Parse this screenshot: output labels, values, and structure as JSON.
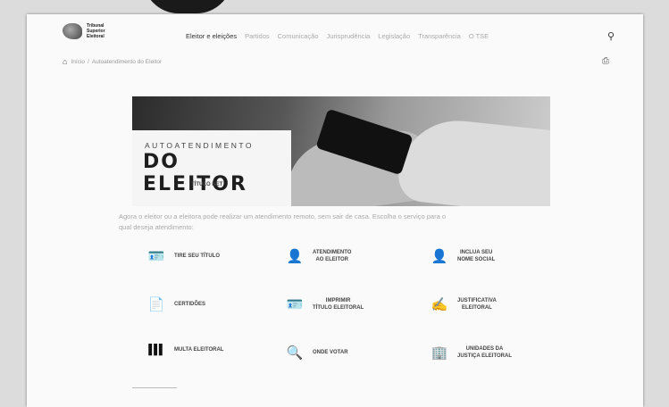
{
  "logo": {
    "line1": "Tribunal",
    "line2": "Superior",
    "line3": "Eleitoral"
  },
  "nav": {
    "items": [
      "Eleitor e eleições",
      "Partidos",
      "Comunicação",
      "Jurisprudência",
      "Legislação",
      "Transparência",
      "O TSE"
    ]
  },
  "breadcrumb": {
    "items": [
      "Início",
      "/",
      "Autoatendimento do Eleitor"
    ]
  },
  "banner": {
    "line1": "AUTOATENDIMENTO",
    "line2": "DO ELEITOR",
    "line3": "TÍTULO NET"
  },
  "intro": "Agora o eleitor ou a eleitora pode realizar um atendimento remoto, sem sair de casa. Escolha o serviço para o qual deseja atendimento:",
  "services": [
    {
      "icon": "id-card-icon",
      "glyph": "🪪",
      "label1": "TIRE SEU TÍTULO",
      "label2": ""
    },
    {
      "icon": "person-icon",
      "glyph": "👤",
      "label1": "ATENDIMENTO",
      "label2": "AO ELEITOR"
    },
    {
      "icon": "person-icon",
      "glyph": "👤",
      "label1": "INCLUA SEU",
      "label2": "NOME SOCIAL"
    },
    {
      "icon": "document-icon",
      "glyph": "📄",
      "label1": "CERTIDÕES",
      "label2": ""
    },
    {
      "icon": "id-card-icon",
      "glyph": "🪪",
      "label1": "IMPRIMIR",
      "label2": "TÍTULO ELEITORAL"
    },
    {
      "icon": "signature-icon",
      "glyph": "✍",
      "label1": "JUSTIFICATIVA",
      "label2": "ELEITORAL"
    },
    {
      "icon": "barcode-icon",
      "glyph": "▌▌▌",
      "label1": "MULTA ELEITORAL",
      "label2": ""
    },
    {
      "icon": "search-icon",
      "glyph": "🔍",
      "label1": "ONDE VOTAR",
      "label2": ""
    },
    {
      "icon": "building-icon",
      "glyph": "🏢",
      "label1": "UNIDADES DA",
      "label2": "JUSTIÇA ELEITORAL"
    }
  ]
}
